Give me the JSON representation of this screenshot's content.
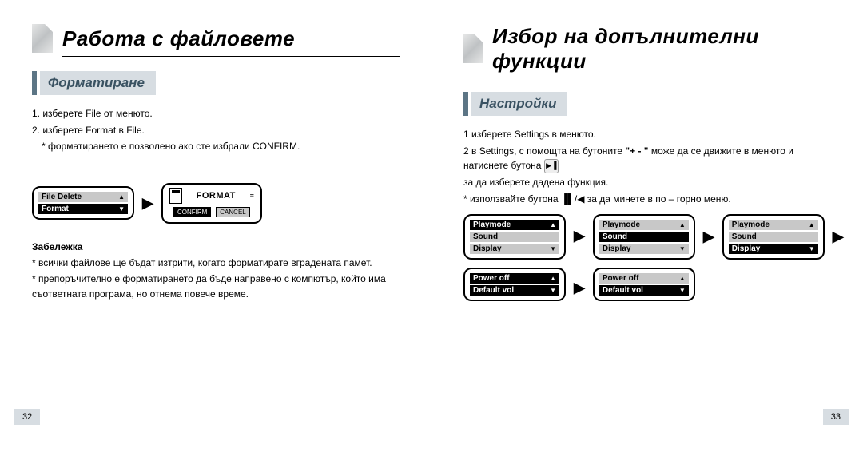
{
  "left": {
    "title": "Работа с  файловете",
    "section": "Форматиране",
    "step1": "1. изберете File от менюто.",
    "step2": "2. изберете Format в File.",
    "step3": "* форматирането е позволено ако сте избрали  CONFIRM.",
    "screen1": {
      "r1": "File Delete",
      "r2": "Format"
    },
    "fmt": {
      "title": "FORMAT",
      "confirm": "CONFIRM",
      "cancel": "CANCEL"
    },
    "noteTitle": "Забележка",
    "note1": "* всички файлове ще бъдат изтрити, когато форматирате вградената памет.",
    "note2": "* препоръчително е форматирането да бъде направено с компютър, който има съответната програма, но отнема повече време.",
    "pageNum": "32"
  },
  "right": {
    "title": "Избор на допълнителни функции",
    "section": "Настройки",
    "step1": "1 изберете  Settings в менюто.",
    "step2a": "2 в  Settings, с помощта на бутоните ",
    "step2b": "\"+  -  \"",
    "step2c": "може да се движите в менюто и натиснете бутона",
    "step2d": "за да изберете дадена функция.",
    "step3": "* използвайте бутона ▐▌/◀ за да минете в по – горно меню.",
    "screenA": {
      "r1": "Playmode",
      "r2": "Sound",
      "r3": "Display"
    },
    "screenB": {
      "r1": "Playmode",
      "r2": "Sound",
      "r3": "Display"
    },
    "screenC": {
      "r1": "Playmode",
      "r2": "Sound",
      "r3": "Display"
    },
    "screenD": {
      "r1": "Power off",
      "r2": "Default vol"
    },
    "screenE": {
      "r1": "Power off",
      "r2": "Default vol"
    },
    "pageNum": "33"
  }
}
